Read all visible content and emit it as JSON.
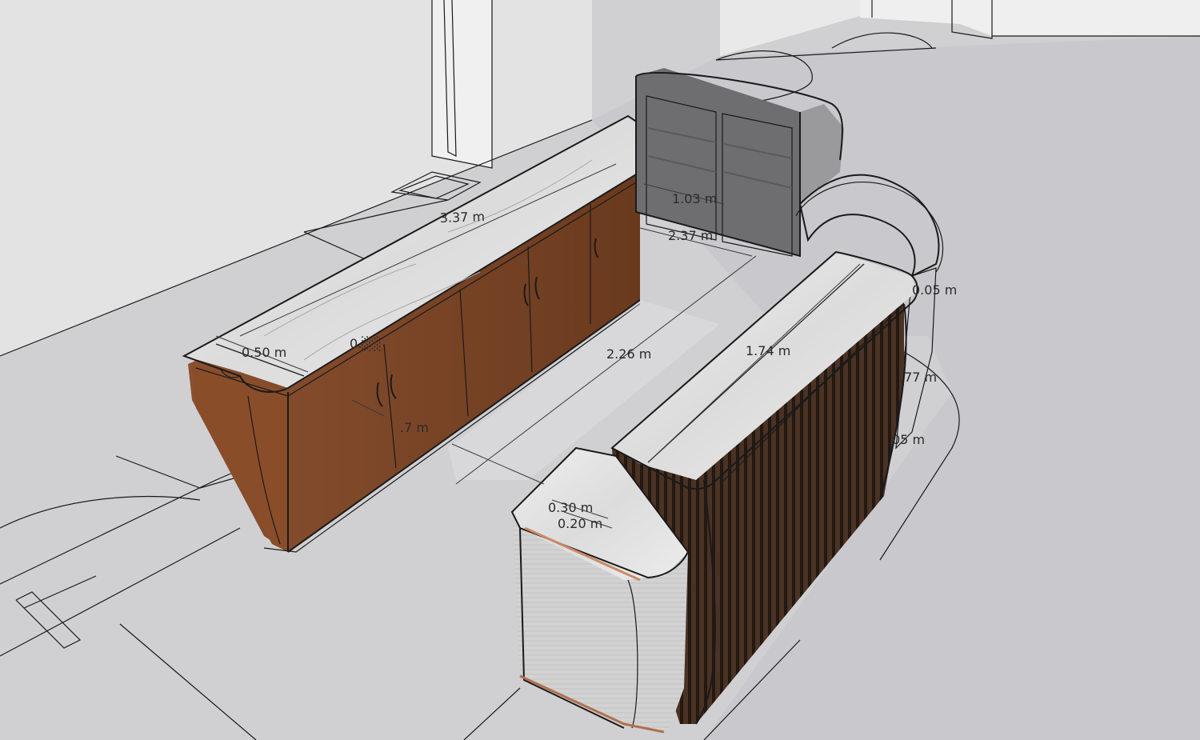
{
  "scene": {
    "description_visible": false,
    "colors": {
      "floor": "#d4d4d4",
      "floor_dark": "#c8c8cc",
      "wall": "#ececec",
      "wood": "#7a4526",
      "wood_dark": "#5a3018",
      "marble": "#e6e6e6",
      "slat": "#3a2a22",
      "metal_panel": "#cfcfcf",
      "glass": "#7a7a7a"
    }
  },
  "dimensions": [
    {
      "id": "dim-337",
      "label": "3.37 m"
    },
    {
      "id": "dim-103",
      "label": "1.03 m"
    },
    {
      "id": "dim-237",
      "label": "2.37 m"
    },
    {
      "id": "dim-050",
      "label": "0.50 m"
    },
    {
      "id": "dim-226",
      "label": "2.26 m"
    },
    {
      "id": "dim-174",
      "label": "1.74 m"
    },
    {
      "id": "dim-030",
      "label": "0.30 m"
    },
    {
      "id": "dim-020",
      "label": "0.20 m"
    },
    {
      "id": "dim-0xx-a",
      "label": "0.░░"
    },
    {
      "id": "dim-0xx-b",
      "label": ".77 m"
    },
    {
      "id": "dim-0xx-c",
      "label": ".05 m"
    },
    {
      "id": "dim-0xx-d",
      "label": "0.05 m"
    },
    {
      "id": "dim-0xx-e",
      "label": ".7 m"
    }
  ]
}
